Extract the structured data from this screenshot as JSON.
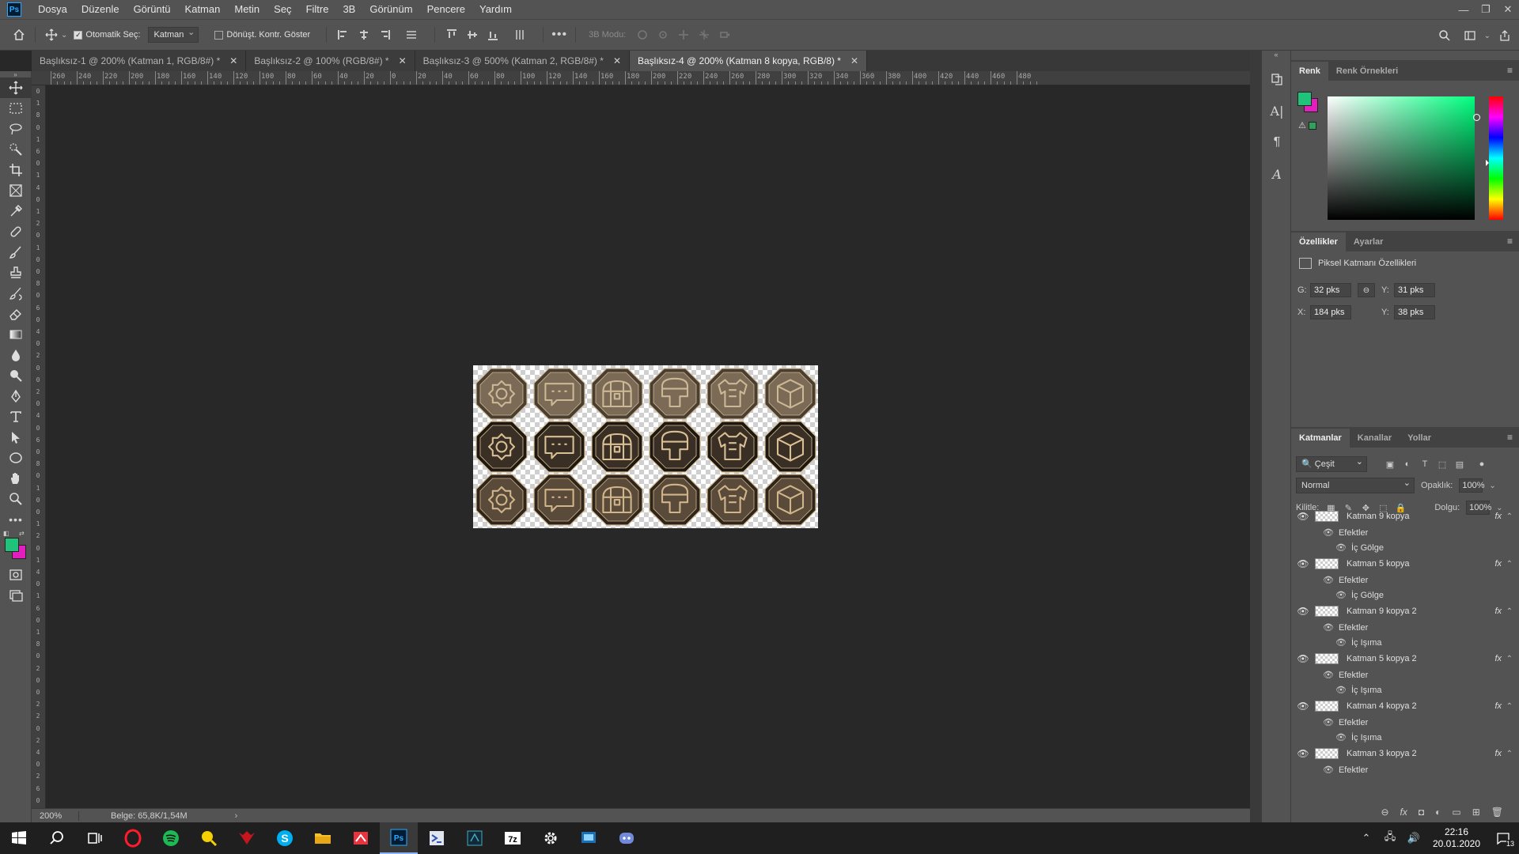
{
  "app": {
    "logo": "Ps",
    "menu": [
      "Dosya",
      "Düzenle",
      "Görüntü",
      "Katman",
      "Metin",
      "Seç",
      "Filtre",
      "3B",
      "Görünüm",
      "Pencere",
      "Yardım"
    ]
  },
  "options": {
    "auto_select_label": "Otomatik Seç:",
    "auto_select_value": "Katman",
    "transform_label": "Dönüşt. Kontr. Göster",
    "mode_3d_label": "3B Modu:"
  },
  "tabs": [
    {
      "label": "Başlıksız-1 @ 200% (Katman 1, RGB/8#) *"
    },
    {
      "label": "Başlıksız-2 @ 100% (RGB/8#) *"
    },
    {
      "label": "Başlıksız-3 @ 500% (Katman 2, RGB/8#) *"
    },
    {
      "label": "Başlıksız-4 @ 200% (Katman 8 kopya, RGB/8) *"
    }
  ],
  "ruler_top_ticks": [
    "260",
    "240",
    "220",
    "200",
    "180",
    "160",
    "140",
    "120",
    "100",
    "80",
    "60",
    "40",
    "20",
    "0",
    "20",
    "40",
    "60",
    "80",
    "100",
    "120",
    "140",
    "160",
    "180",
    "200",
    "220",
    "240",
    "260",
    "280",
    "300",
    "320",
    "340",
    "360",
    "380",
    "400",
    "420",
    "440",
    "460",
    "480"
  ],
  "ruler_left_ticks": [
    "0",
    "1",
    "8",
    "0",
    "1",
    "6",
    "0",
    "1",
    "4",
    "0",
    "1",
    "2",
    "0",
    "1",
    "0",
    "0",
    "8",
    "0",
    "6",
    "0",
    "4",
    "0",
    "2",
    "0",
    "0",
    "2",
    "0",
    "4",
    "0",
    "6",
    "0",
    "8",
    "0",
    "1",
    "0",
    "0",
    "1",
    "2",
    "0",
    "1",
    "4",
    "0",
    "1",
    "6",
    "0",
    "1",
    "8",
    "0",
    "2",
    "0",
    "0",
    "2",
    "2",
    "0",
    "2",
    "4",
    "0",
    "2",
    "6",
    "0"
  ],
  "document": {
    "icon_rows": [
      {
        "style": "light",
        "icons": [
          "gear",
          "chat",
          "chest",
          "helmet",
          "armor",
          "box"
        ]
      },
      {
        "style": "dark",
        "icons": [
          "gear",
          "chat",
          "chest",
          "helmet",
          "armor",
          "box"
        ]
      },
      {
        "style": "medium",
        "icons": [
          "gear",
          "chat",
          "chest",
          "helmet",
          "armor",
          "box"
        ]
      }
    ]
  },
  "status": {
    "zoom": "200%",
    "doc_info": "Belge: 65,8K/1,54M"
  },
  "colors": {
    "foreground": "#1fc47a",
    "background": "#e21fbd"
  },
  "color_panel": {
    "tabs": [
      "Renk",
      "Renk Örnekleri"
    ]
  },
  "properties": {
    "tabs": [
      "Özellikler",
      "Ayarlar"
    ],
    "title": "Piksel Katmanı Özellikleri",
    "w_label": "G:",
    "w_value": "32 pks",
    "h_label": "Y:",
    "h_value": "31 pks",
    "x_label": "X:",
    "x_value": "184 pks",
    "y_label": "Y:",
    "y_value": "38 pks"
  },
  "layers": {
    "tabs": [
      "Katmanlar",
      "Kanallar",
      "Yollar"
    ],
    "filter": "Çeşit",
    "blend_mode": "Normal",
    "opacity_label": "Opaklık:",
    "opacity": "100%",
    "lock_label": "Kilitle:",
    "fill_label": "Dolgu:",
    "fill": "100%",
    "effects_label": "Efektler",
    "fx_label": "fx",
    "items": [
      {
        "name": "Katman 9 kopya",
        "effect": "İç Gölge"
      },
      {
        "name": "Katman 5 kopya",
        "effect": "İç Gölge"
      },
      {
        "name": "Katman 9 kopya 2",
        "effect": "İç Işıma"
      },
      {
        "name": "Katman 5 kopya 2",
        "effect": "İç Işıma"
      },
      {
        "name": "Katman 4 kopya 2",
        "effect": "İç Işıma"
      },
      {
        "name": "Katman 3 kopya 2",
        "effect": ""
      }
    ]
  },
  "taskbar": {
    "time": "22:16",
    "date": "20.01.2020",
    "notifications": "13"
  }
}
